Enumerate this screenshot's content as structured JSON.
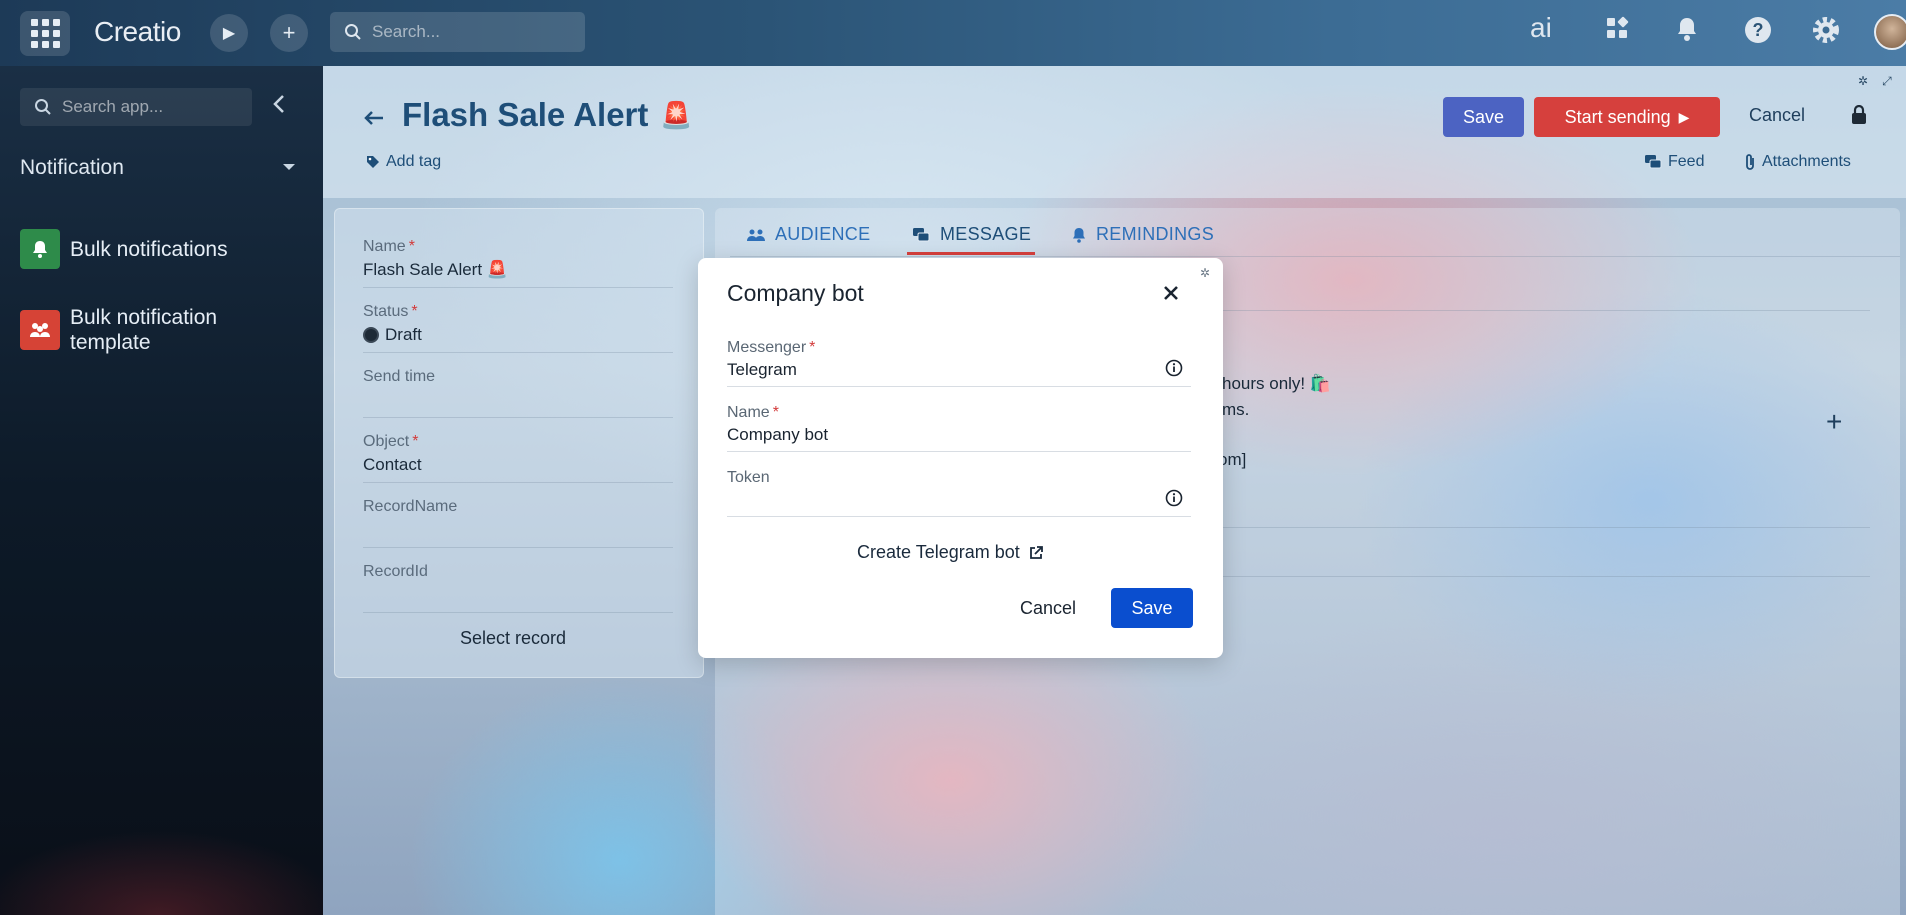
{
  "topbar": {
    "logo": "Creatio",
    "search_placeholder": "Search...",
    "ai_label": "ai"
  },
  "sidebar": {
    "search_placeholder": "Search app...",
    "section": "Notification",
    "items": [
      {
        "label": "Bulk notifications",
        "color": "#2e8b4a"
      },
      {
        "label": "Bulk notification template",
        "color": "#d64336"
      }
    ]
  },
  "header": {
    "title": "Flash Sale Alert",
    "title_emoji": "🚨",
    "add_tag": "Add tag",
    "save": "Save",
    "start_sending": "Start sending",
    "cancel": "Cancel",
    "feed": "Feed",
    "attachments": "Attachments"
  },
  "record": {
    "name_label": "Name",
    "name_value": "Flash Sale Alert 🚨",
    "status_label": "Status",
    "status_value": "Draft",
    "send_time_label": "Send time",
    "object_label": "Object",
    "object_value": "Contact",
    "record_name_label": "RecordName",
    "record_id_label": "RecordId",
    "select_record": "Select record"
  },
  "tabs": [
    {
      "label": "AUDIENCE"
    },
    {
      "label": "MESSAGE"
    },
    {
      "label": "REMINDINGS"
    }
  ],
  "background_message": {
    "line1": "hours only! 🛍️",
    "line2": "ms.",
    "line3": "om]"
  },
  "modal": {
    "title": "Company bot",
    "messenger_label": "Messenger",
    "messenger_value": "Telegram",
    "name_label": "Name",
    "name_value": "Company bot",
    "token_label": "Token",
    "token_value": "",
    "create_bot": "Create Telegram bot",
    "cancel": "Cancel",
    "save": "Save"
  },
  "colors": {
    "primary": "#0a4ecf",
    "header_save": "#4c63c2",
    "start_sending": "#d6403d",
    "required": "#d23a3a"
  }
}
